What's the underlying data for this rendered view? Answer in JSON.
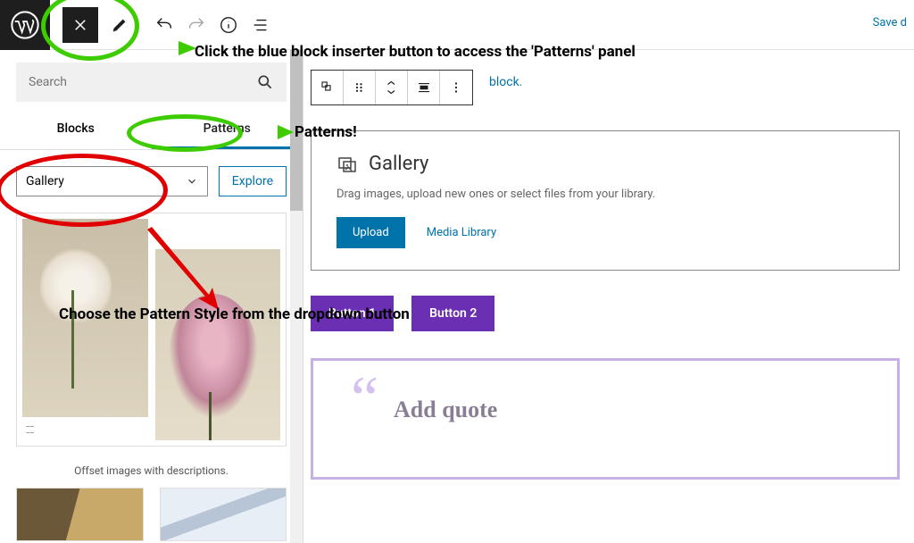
{
  "topbar": {
    "save_draft": "Save d"
  },
  "sidebar": {
    "search_placeholder": "Search",
    "tabs": {
      "blocks": "Blocks",
      "patterns": "Patterns"
    },
    "dropdown_value": "Gallery",
    "explore": "Explore",
    "pattern_caption": "Offset images with descriptions."
  },
  "canvas": {
    "block_hint": "block.",
    "gallery": {
      "title": "Gallery",
      "subtitle": "Drag images, upload new ones or select files from your library.",
      "upload": "Upload",
      "media_library": "Media Library"
    },
    "buttons": {
      "b1": "Button 1",
      "b2": "Button 2"
    },
    "quote_placeholder": "Add quote"
  },
  "annotations": {
    "line1": "Click the blue block inserter button to access the 'Patterns' panel",
    "line2": "Patterns!",
    "line3": "Choose the Pattern Style from the dropdown button"
  }
}
